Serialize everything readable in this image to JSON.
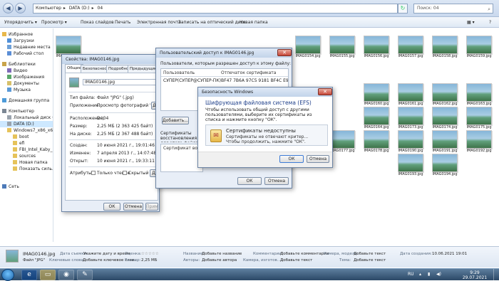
{
  "explorer": {
    "breadcrumb": [
      "Компьютер",
      "DATA (D:)",
      "04"
    ],
    "search_placeholder": "Поиск: 04",
    "toolbar": [
      "Упорядочить ▾",
      "Просмотр ▾",
      "Показ слайдов",
      "Печать",
      "Электронная почта",
      "Записать на оптический диск",
      "Новая папка"
    ],
    "nav": [
      {
        "label": "Избранное",
        "sel": false
      },
      {
        "label": "Загрузки",
        "sel": false
      },
      {
        "label": "Недавние места",
        "sel": false
      },
      {
        "label": "Рабочий стол",
        "sel": false
      },
      {
        "label": "Библиотеки",
        "sel": false
      },
      {
        "label": "Видео",
        "sel": false
      },
      {
        "label": "Изображения",
        "sel": false
      },
      {
        "label": "Документы",
        "sel": false
      },
      {
        "label": "Музыка",
        "sel": false
      },
      {
        "label": "Домашняя группа",
        "sel": false
      },
      {
        "label": "Компьютер",
        "sel": false
      },
      {
        "label": "Локальный диск (C:)",
        "sel": false
      },
      {
        "label": "DATA (D:)",
        "sel": true
      },
      {
        "label": "Windows7_x86_x64_Ul",
        "sel": false
      },
      {
        "label": "boot",
        "sel": false
      },
      {
        "label": "efi",
        "sel": false
      },
      {
        "label": "FBI_Intel_Kaby_Lak",
        "sel": false
      },
      {
        "label": "sources",
        "sel": false
      },
      {
        "label": "Новая папка",
        "sel": false
      },
      {
        "label": "Показать силь.р",
        "sel": false
      },
      {
        "label": "Сеть",
        "sel": false
      }
    ],
    "thumbs": [
      {
        "name": "IMAG0146.jpg"
      },
      {
        "name": "IMAG0154.jpg"
      },
      {
        "name": "IMAG0155.jpg"
      },
      {
        "name": "IMAG0156.jpg"
      },
      {
        "name": "IMAG0157.jpg"
      },
      {
        "name": "IMAG0158.jpg"
      },
      {
        "name": "IMAG0159.jpg"
      },
      {
        "name": "IMAG0160.jpg"
      },
      {
        "name": "IMAG0161.jpg"
      },
      {
        "name": "IMAG0162.jpg"
      },
      {
        "name": "IMAG0163.jpg"
      },
      {
        "name": "IMAG0164.jpg"
      },
      {
        "name": "IMAG0173.jpg"
      },
      {
        "name": "IMAG0174.jpg"
      },
      {
        "name": "IMAG0175.jpg"
      },
      {
        "name": "IMAG0176.jpg"
      },
      {
        "name": "IMAG0177.jpg"
      },
      {
        "name": "IMAG0178.jpg"
      },
      {
        "name": "IMAG0190.jpg"
      },
      {
        "name": "IMAG0191.jpg"
      },
      {
        "name": "IMAG0192.jpg"
      },
      {
        "name": "IMAG0193.jpg"
      },
      {
        "name": "IMAG0194.jpg"
      }
    ]
  },
  "props": {
    "title": "Свойства: IMAG0146.jpg",
    "tabs": [
      "Общие",
      "Безопасность",
      "Подробно",
      "Предыдущие версии"
    ],
    "filename": "IMAG0146.jpg",
    "rows": [
      {
        "k": "Тип файла:",
        "v": "Файл \"JPG\" (.jpg)"
      },
      {
        "k": "Приложение:",
        "v": "Просмотр фотографий Windows"
      },
      {
        "k": "Расположение:",
        "v": "D:\\04"
      },
      {
        "k": "Размер:",
        "v": "2,25 МБ (2 363 425 байт)"
      },
      {
        "k": "На диске:",
        "v": "2,25 МБ (2 367 488 байт)"
      },
      {
        "k": "Создан:",
        "v": "10 июня 2021 г., 19:01:46"
      },
      {
        "k": "Изменен:",
        "v": "7 апреля 2013 г., 14:07:48"
      },
      {
        "k": "Открыт:",
        "v": "10 июня 2021 г., 19:33:11"
      }
    ],
    "attr_label": "Атрибуты:",
    "readonly": "Только чтение",
    "hidden": "Скрытый",
    "change_btn": "Д",
    "other_btn": "Д",
    "ok": "ОК",
    "cancel": "Отмена",
    "apply": "Применить"
  },
  "access": {
    "title": "Пользовательский доступ к IMAG0146.jpg",
    "intro": "Пользователи, которым разрешен доступ к этому файлу:",
    "col_user": "Пользователь",
    "col_cert": "Отпечаток сертификата",
    "user": "СУПЕР(СУПЕР@СУПЕР-ПК)",
    "thumbprint": "BF47 7B6A 97C5 9181 BF4C E945 3627 7...",
    "add_btn": "Добавить...",
    "recovery_label": "Сертификаты восстановления для этого файла, определяемые политикой восстановления:",
    "recovery_col": "Сертификат восстановления",
    "ok": "ОК",
    "cancel": "Отмена"
  },
  "efs": {
    "title": "Безопасность Windows",
    "heading": "Шифрующая файловая система (EFS)",
    "text": "Чтобы использовать общий доступ с другими пользователями, выберите их сертификаты из списка и нажмите кнопку \"ОК\".",
    "cert_title": "Сертификаты недоступны",
    "cert_line1": "Сертификаты не отвечают критер...",
    "cert_line2": "Чтобы продолжить, нажмите \"ОК\".",
    "ok": "ОК",
    "cancel": "Отмена"
  },
  "details": {
    "filename": "IMAG0146.jpg",
    "filetype": "Файл \"JPG\"",
    "items": [
      {
        "k": "Дата съемки:",
        "v": "Укажите дату и время"
      },
      {
        "k": "Оценка:",
        "v": "☆☆☆☆☆"
      },
      {
        "k": "Название:",
        "v": "Добавьте название"
      },
      {
        "k": "Комментарии:",
        "v": "Добавьте комментарии"
      },
      {
        "k": "Камера, модель:",
        "v": "Добавьте текст"
      },
      {
        "k": "Дата создания:",
        "v": "10.06.2021 19:01"
      },
      {
        "k": "Ключевые слова:",
        "v": "Добавьте ключевое слов..."
      },
      {
        "k": "Размер:",
        "v": "2,25 МБ"
      },
      {
        "k": "Авторы:",
        "v": "Добавьте автора"
      },
      {
        "k": "Камера, изготов...:",
        "v": "Добавьте текст"
      },
      {
        "k": "Тема:",
        "v": "Добавьте текст"
      }
    ]
  },
  "taskbar": {
    "lang": "RU",
    "time": "9:29",
    "date": "29.07.2021"
  }
}
